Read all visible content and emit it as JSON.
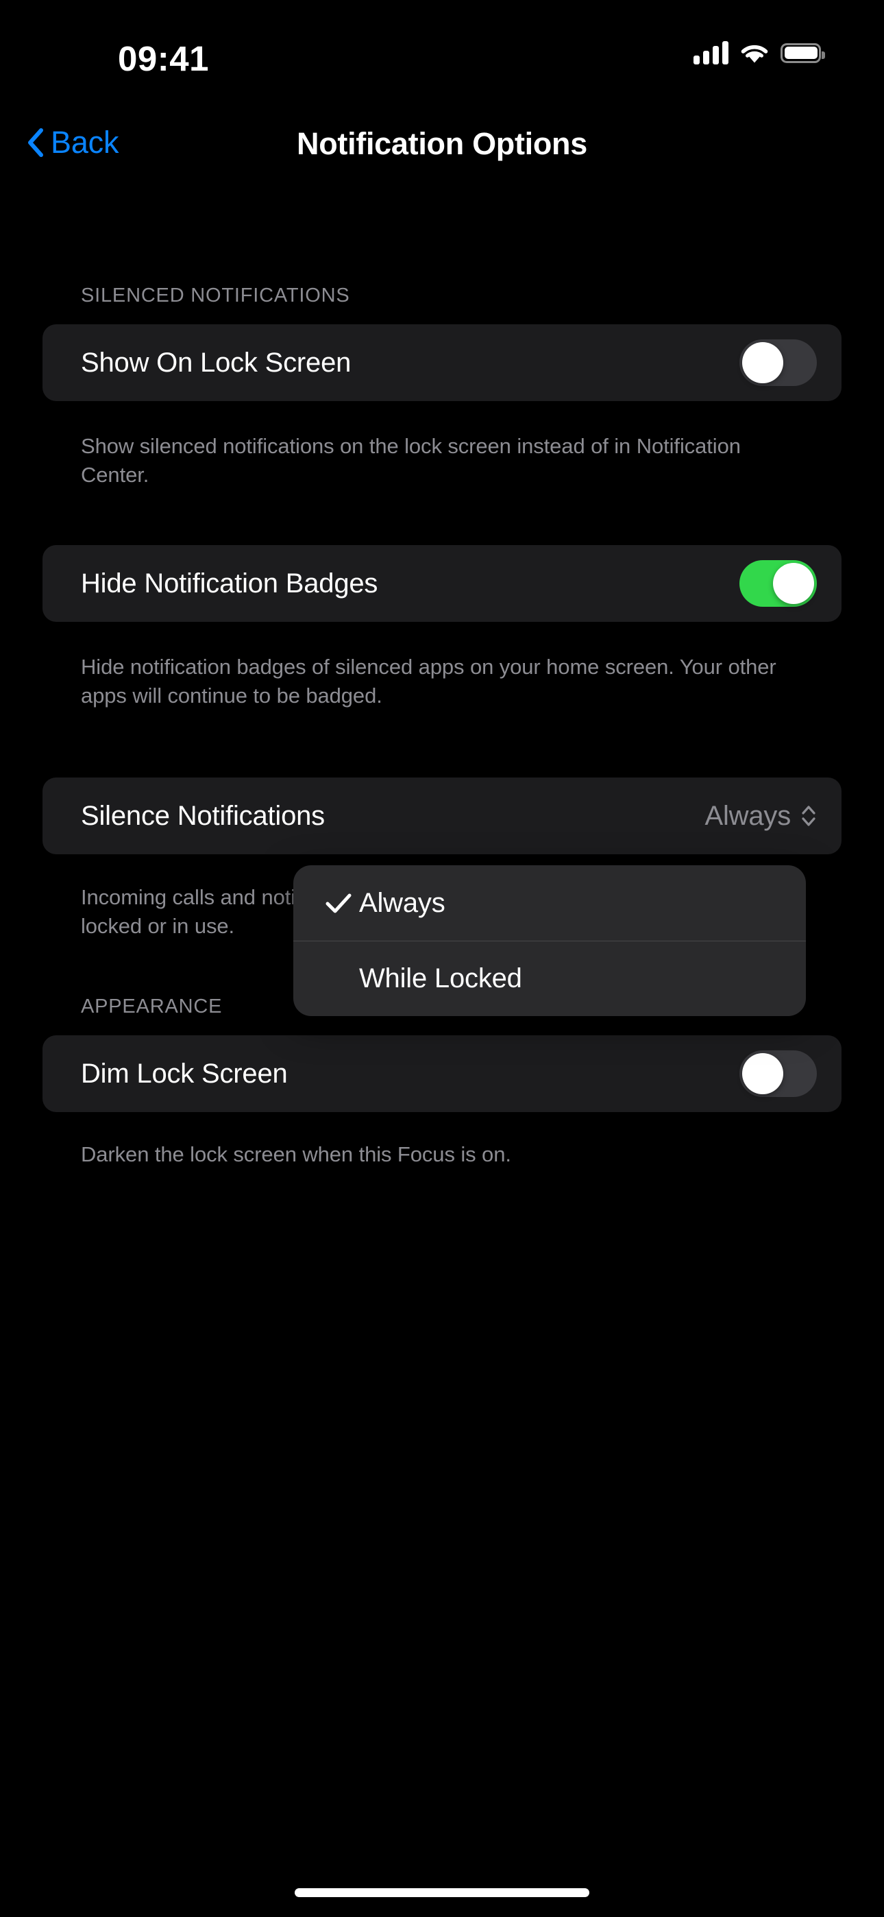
{
  "status_bar": {
    "time": "09:41",
    "cellular_icon": "cellular-signal-icon",
    "wifi_icon": "wifi-icon",
    "battery_icon": "battery-full-icon"
  },
  "nav": {
    "back_label": "Back",
    "back_icon": "chevron-left-icon",
    "title": "Notification Options",
    "accent_color": "#0a84ff"
  },
  "sections": [
    {
      "header": "SILENCED NOTIFICATIONS",
      "rows": [
        {
          "label": "Show On Lock Screen",
          "control": "toggle",
          "value": "off",
          "footer": "Show silenced notifications on the lock screen instead of in Notification Center."
        },
        {
          "label": "Hide Notification Badges",
          "control": "toggle",
          "value": "on",
          "footer": "Hide notification badges of silenced apps on your home screen. Your other apps will continue to be badged."
        },
        {
          "label": "Silence Notifications",
          "control": "popup-menu",
          "value": "Always",
          "chevron_icon": "chevron-up-down-icon",
          "footer": "Incoming calls and notifications will be silenced while this device is either locked or in use."
        }
      ]
    },
    {
      "header": "APPEARANCE",
      "rows": [
        {
          "label": "Dim Lock Screen",
          "control": "toggle",
          "value": "off",
          "footer": "Darken the lock screen when this Focus is on."
        }
      ]
    }
  ],
  "popup_menu": {
    "open": true,
    "anchor_row": "Silence Notifications",
    "items": [
      {
        "label": "Always",
        "selected": true,
        "check_icon": "checkmark-icon"
      },
      {
        "label": "While Locked",
        "selected": false,
        "check_icon": ""
      }
    ]
  },
  "colors": {
    "background": "#000000",
    "card": "#1c1c1e",
    "menu": "#2a2a2c",
    "toggle_on": "#32d74b",
    "toggle_off": "#39393d",
    "secondary_text": "#8d8d93",
    "accent": "#0a84ff"
  },
  "home_indicator": "home-indicator"
}
